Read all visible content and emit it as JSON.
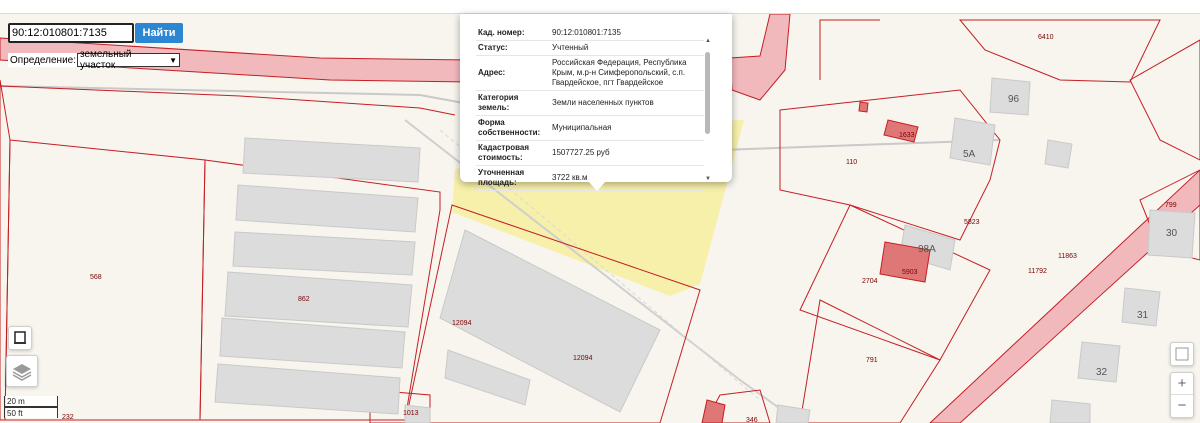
{
  "search": {
    "value": "90:12:010801:7135",
    "button_label": "Найти"
  },
  "definition": {
    "label": "Определение:",
    "selected": "земельный участок"
  },
  "popup": {
    "rows": [
      {
        "key": "Кад. номер:",
        "value": "90:12:010801:7135"
      },
      {
        "key": "Статус:",
        "value": "Учтенный"
      },
      {
        "key": "Адрес:",
        "value": "Российская Федерация, Республика Крым, м.р-н Симферопольский, с.п. Гвардейское, пгт Гвардейское"
      },
      {
        "key": "Категория земель:",
        "value": "Земли населенных пунктов"
      },
      {
        "key": "Форма собственности:",
        "value": "Муниципальная"
      },
      {
        "key": "Кадастровая стоимость:",
        "value": "1507727.25 руб"
      },
      {
        "key": "Уточненная площадь:",
        "value": "3722 кв.м"
      }
    ],
    "scroll_up": "▲",
    "scroll_down": "▼"
  },
  "scale": {
    "metric": "20 m",
    "imperial": "50 ft"
  },
  "zoom": {
    "in": "+",
    "out": "−"
  },
  "map": {
    "parcel_labels": [
      "568",
      "862",
      "12094",
      "12094",
      "1013",
      "232",
      "110",
      "1633",
      "5823",
      "5903",
      "2704",
      "791",
      "11792",
      "11863",
      "799",
      "6410",
      "346"
    ],
    "building_numbers": [
      "96",
      "5А",
      "98А",
      "30",
      "31",
      "32"
    ],
    "colors": {
      "parcel_border": "#c41e24",
      "road": "#f2b9bd",
      "building": "#dcdcdc",
      "selected_parcel": "#f7ee9e",
      "highlight_building": "#e07777"
    }
  }
}
